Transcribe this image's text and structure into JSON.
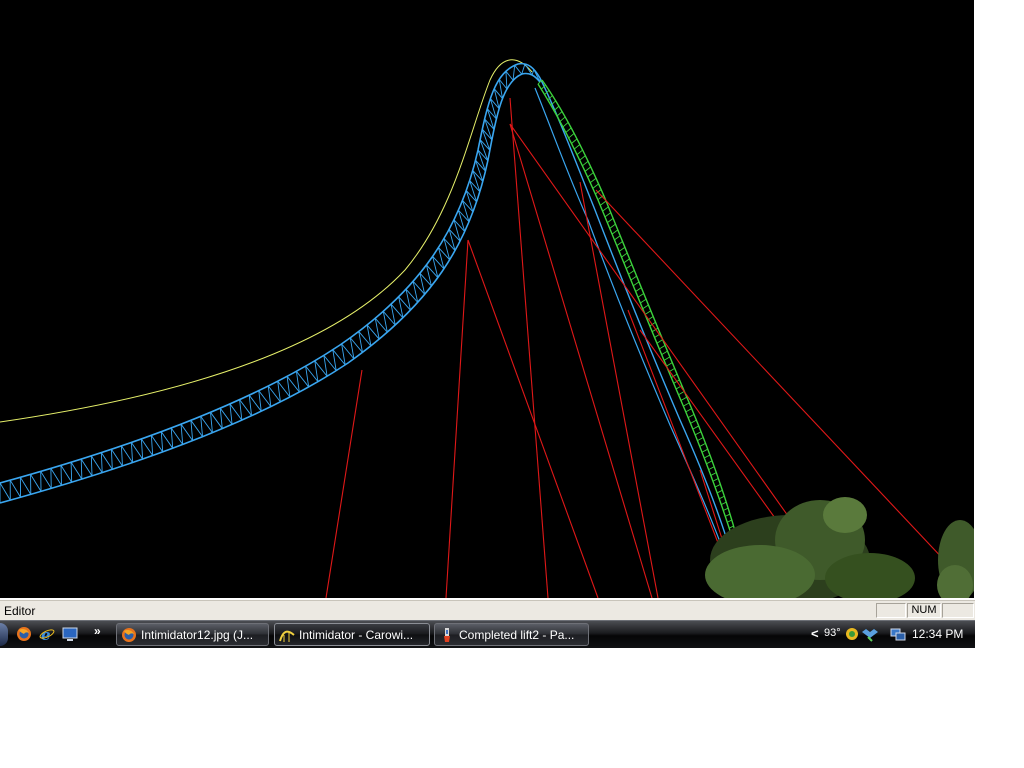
{
  "statusbar": {
    "text": "Editor",
    "panes": [
      "",
      "NUM",
      ""
    ]
  },
  "quick_launch": {
    "icons": [
      "firefox-icon",
      "internet-explorer-icon",
      "show-desktop-icon"
    ],
    "more": "»"
  },
  "taskbar": {
    "buttons": [
      {
        "label": "Intimidator12.jpg (J...",
        "icon": "firefox-icon",
        "active": false
      },
      {
        "label": "Intimidator - Carowi...",
        "icon": "coaster-editor-icon",
        "active": true
      },
      {
        "label": "Completed lift2 - Pa...",
        "icon": "paint-icon",
        "active": false
      }
    ]
  },
  "tray": {
    "expand": "<",
    "temperature": "93°",
    "icons": [
      "weather-icon",
      "dropbox-icon",
      "network-icon"
    ],
    "clock": "12:34 PM"
  },
  "colors": {
    "viewport_bg": "#000000",
    "track_blue": "#3aa6f0",
    "guide_yellow": "#e6f06a",
    "lift_green": "#3cd23c",
    "support_red": "#e01818",
    "foliage": "#3f5a2a"
  }
}
